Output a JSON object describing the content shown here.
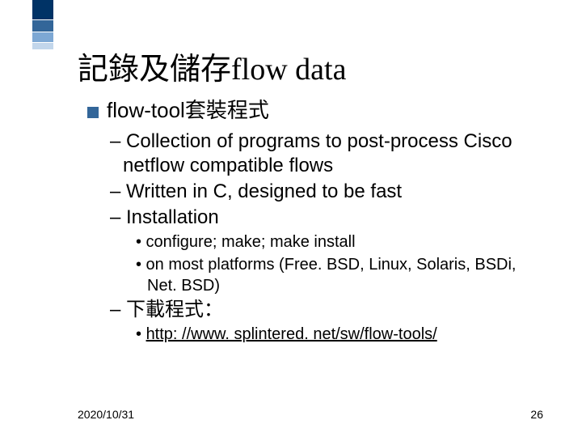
{
  "title": "記錄及儲存flow data",
  "bullet1": "flow-tool套裝程式",
  "sub1": "– Collection of programs to post-process Cisco netflow compatible flows",
  "sub2": "– Written in C, designed to be fast",
  "sub3": "– Installation",
  "subsub1": "• configure; make; make install",
  "subsub2": "• on most platforms (Free. BSD, Linux, Solaris, BSDi, Net. BSD)",
  "sub4": "– 下載程式：",
  "subsub3_prefix": "• ",
  "subsub3_link": "http: //www. splintered. net/sw/flow-tools/",
  "date": "2020/10/31",
  "page": "26"
}
